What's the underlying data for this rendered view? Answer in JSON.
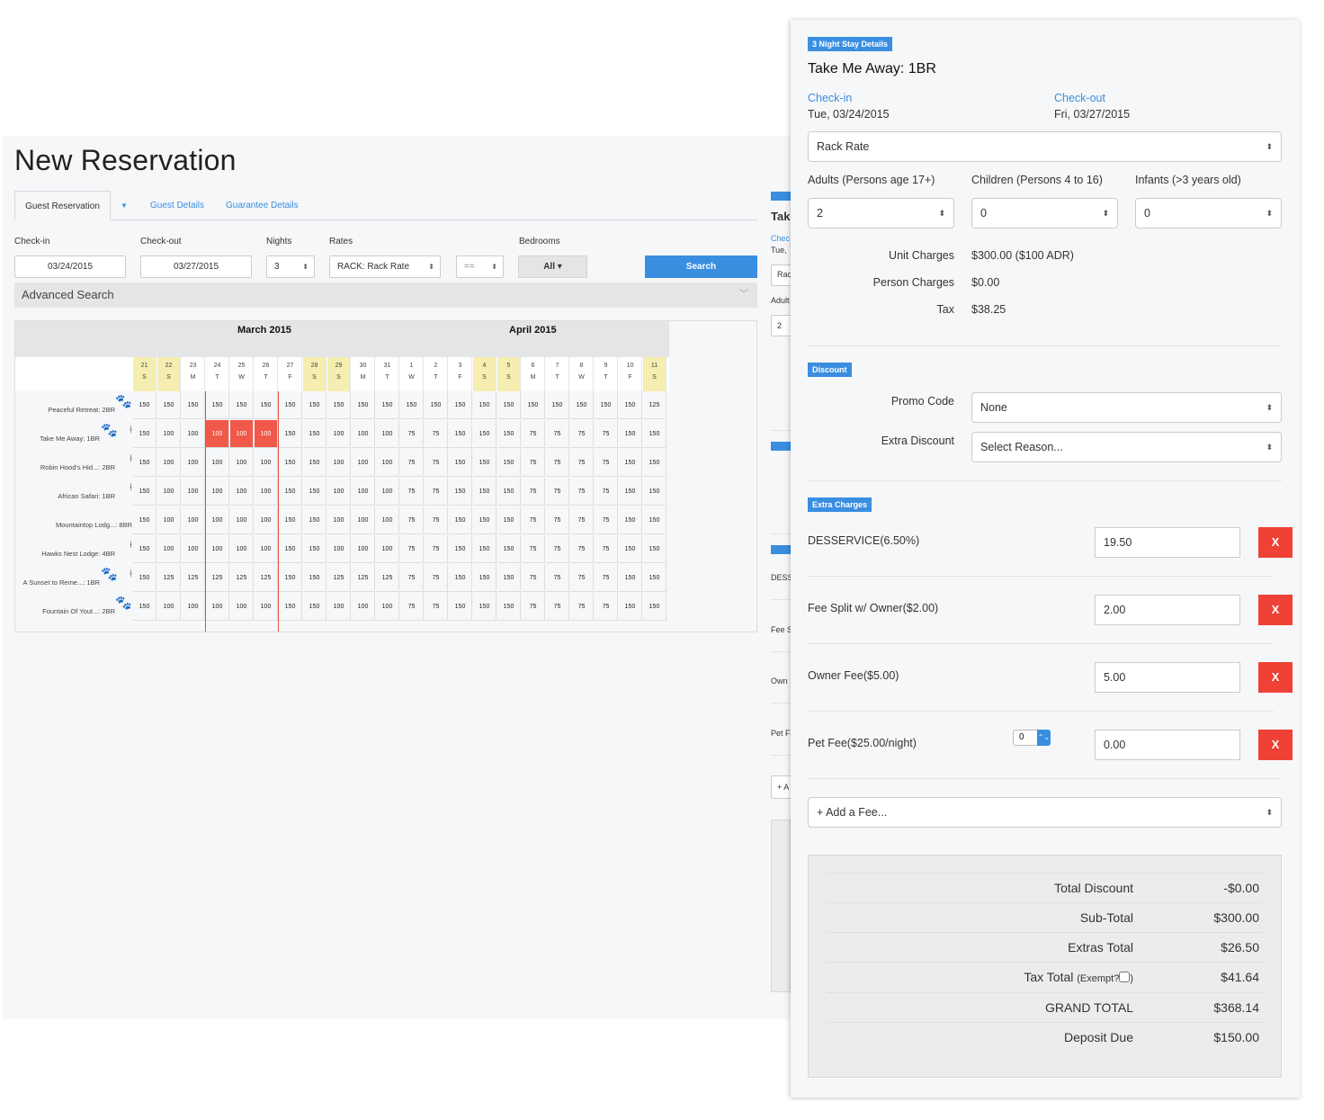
{
  "page": {
    "title": "New Reservation",
    "tabs": [
      {
        "label": "Guest Reservation",
        "active": true
      },
      {
        "label": "Guest Details",
        "active": false
      },
      {
        "label": "Guarantee Details",
        "active": false
      }
    ],
    "tab_caret": "▼"
  },
  "search_form": {
    "checkin_label": "Check-in",
    "checkin_value": "03/24/2015",
    "checkout_label": "Check-out",
    "checkout_value": "03/27/2015",
    "nights_label": "Nights",
    "nights_value": "3",
    "rates_label": "Rates",
    "rates_value": "RACK: Rack Rate",
    "operator_value": "==",
    "bedrooms_label": "Bedrooms",
    "bedrooms_value": "All ▾",
    "search_button": "Search",
    "advanced_search": "Advanced Search",
    "spin_glyph": "⬍",
    "chevron_glyph": "﹀"
  },
  "calendar": {
    "months": [
      {
        "label": "March 2015"
      },
      {
        "label": "April 2015"
      }
    ],
    "days": [
      {
        "num": "21",
        "dow": "S",
        "weekend": true
      },
      {
        "num": "22",
        "dow": "S",
        "weekend": true
      },
      {
        "num": "23",
        "dow": "M",
        "weekend": false
      },
      {
        "num": "24",
        "dow": "T",
        "weekend": false
      },
      {
        "num": "25",
        "dow": "W",
        "weekend": false
      },
      {
        "num": "26",
        "dow": "T",
        "weekend": false
      },
      {
        "num": "27",
        "dow": "F",
        "weekend": false
      },
      {
        "num": "28",
        "dow": "S",
        "weekend": true
      },
      {
        "num": "29",
        "dow": "S",
        "weekend": true
      },
      {
        "num": "30",
        "dow": "M",
        "weekend": false
      },
      {
        "num": "31",
        "dow": "T",
        "weekend": false
      },
      {
        "num": "1",
        "dow": "W",
        "weekend": false
      },
      {
        "num": "2",
        "dow": "T",
        "weekend": false
      },
      {
        "num": "3",
        "dow": "F",
        "weekend": false
      },
      {
        "num": "4",
        "dow": "S",
        "weekend": true
      },
      {
        "num": "5",
        "dow": "S",
        "weekend": true
      },
      {
        "num": "6",
        "dow": "M",
        "weekend": false
      },
      {
        "num": "7",
        "dow": "T",
        "weekend": false
      },
      {
        "num": "8",
        "dow": "W",
        "weekend": false
      },
      {
        "num": "9",
        "dow": "T",
        "weekend": false
      },
      {
        "num": "10",
        "dow": "F",
        "weekend": false
      },
      {
        "num": "11",
        "dow": "S",
        "weekend": true
      }
    ],
    "selected_range": {
      "unit_index": 1,
      "start_day_index": 3,
      "end_day_index": 5
    },
    "units": [
      {
        "name": "Peaceful Retreat: 2BR",
        "pets": true,
        "cleaning": false,
        "rates": [
          "150",
          "150",
          "150",
          "150",
          "150",
          "150",
          "150",
          "150",
          "150",
          "150",
          "150",
          "150",
          "150",
          "150",
          "150",
          "150",
          "150",
          "150",
          "150",
          "150",
          "150",
          "125"
        ]
      },
      {
        "name": "Take Me Away: 1BR",
        "pets": true,
        "cleaning": true,
        "rates": [
          "150",
          "100",
          "100",
          "100",
          "100",
          "100",
          "150",
          "150",
          "100",
          "100",
          "100",
          "75",
          "75",
          "150",
          "150",
          "150",
          "75",
          "75",
          "75",
          "75",
          "150",
          "150"
        ]
      },
      {
        "name": "Robin Hood's Hid...: 2BR",
        "pets": false,
        "cleaning": true,
        "rates": [
          "150",
          "100",
          "100",
          "100",
          "100",
          "100",
          "150",
          "150",
          "100",
          "100",
          "100",
          "75",
          "75",
          "150",
          "150",
          "150",
          "75",
          "75",
          "75",
          "75",
          "150",
          "150"
        ]
      },
      {
        "name": "African Safari: 1BR",
        "pets": false,
        "cleaning": true,
        "rates": [
          "150",
          "100",
          "100",
          "100",
          "100",
          "100",
          "150",
          "150",
          "100",
          "100",
          "100",
          "75",
          "75",
          "150",
          "150",
          "150",
          "75",
          "75",
          "75",
          "75",
          "150",
          "150"
        ]
      },
      {
        "name": "Mountaintop Lodg...: 8BR",
        "pets": false,
        "cleaning": false,
        "rates": [
          "150",
          "100",
          "100",
          "100",
          "100",
          "100",
          "150",
          "150",
          "100",
          "100",
          "100",
          "75",
          "75",
          "150",
          "150",
          "150",
          "75",
          "75",
          "75",
          "75",
          "150",
          "150"
        ]
      },
      {
        "name": "Hawks Nest Lodge: 4BR",
        "pets": false,
        "cleaning": true,
        "rates": [
          "150",
          "100",
          "100",
          "100",
          "100",
          "100",
          "150",
          "150",
          "100",
          "100",
          "100",
          "75",
          "75",
          "150",
          "150",
          "150",
          "75",
          "75",
          "75",
          "75",
          "150",
          "150"
        ]
      },
      {
        "name": "A Sunset to Reme...: 1BR",
        "pets": true,
        "cleaning": true,
        "rates": [
          "150",
          "125",
          "125",
          "125",
          "125",
          "125",
          "150",
          "150",
          "125",
          "125",
          "125",
          "75",
          "75",
          "150",
          "150",
          "150",
          "75",
          "75",
          "75",
          "75",
          "150",
          "150"
        ]
      },
      {
        "name": "Fountain Of Yout...: 2BR",
        "pets": true,
        "cleaning": false,
        "rates": [
          "150",
          "100",
          "100",
          "100",
          "100",
          "100",
          "150",
          "150",
          "100",
          "100",
          "100",
          "75",
          "75",
          "150",
          "150",
          "150",
          "75",
          "75",
          "75",
          "75",
          "150",
          "150"
        ]
      }
    ],
    "icons": {
      "paw": "🐾",
      "broom": "⟊"
    }
  },
  "peek_panel": {
    "title": "Tak",
    "checkin_link": "Chec",
    "checkin_date": "Tue,",
    "rate": "Rac",
    "adults_label": "Adult",
    "adults_value": "2",
    "row1": "DESS",
    "row2": "Fee S",
    "row3": "Own",
    "row4": "Pet F",
    "add_fee": "+ A"
  },
  "stay_panel": {
    "badge": "3 Night Stay Details",
    "unit_title": "Take Me Away: 1BR",
    "checkin_label": "Check-in",
    "checkin_date": "Tue, 03/24/2015",
    "checkout_label": "Check-out",
    "checkout_date": "Fri, 03/27/2015",
    "rate_select": "Rack Rate",
    "adults_label": "Adults (Persons age 17+)",
    "adults_value": "2",
    "children_label": "Children (Persons 4 to 16)",
    "children_value": "0",
    "infants_label": "Infants (>3 years old)",
    "infants_value": "0",
    "unit_charges_label": "Unit Charges",
    "unit_charges_value": "$300.00 ($100 ADR)",
    "person_charges_label": "Person Charges",
    "person_charges_value": "$0.00",
    "tax_label": "Tax",
    "tax_value": "$38.25",
    "select_arrows": "⬍",
    "discount": {
      "badge": "Discount",
      "promo_label": "Promo Code",
      "promo_value": "None",
      "extra_label": "Extra Discount",
      "extra_value": "Select Reason..."
    },
    "extra_charges": {
      "badge": "Extra Charges",
      "remove_label": "X",
      "items": [
        {
          "label": "DESSERVICE(6.50%)",
          "value": "19.50"
        },
        {
          "label": "Fee Split w/ Owner($2.00)",
          "value": "2.00"
        },
        {
          "label": "Owner Fee($5.00)",
          "value": "5.00"
        },
        {
          "label": "Pet Fee($25.00/night)",
          "value": "0.00",
          "pet_count": "0"
        }
      ],
      "stepper_glyph": "⌃⌄",
      "add_fee": "+ Add a Fee..."
    },
    "totals": {
      "total_discount_label": "Total Discount",
      "total_discount": "-$0.00",
      "subtotal_label": "Sub-Total",
      "subtotal": "$300.00",
      "extras_label": "Extras Total",
      "extras": "$26.50",
      "tax_label": "Tax Total",
      "tax_exempt_label": "(Exempt?",
      "tax_exempt_close": ")",
      "tax_exempt_checked": false,
      "tax": "$41.64",
      "grand_label": "GRAND TOTAL",
      "grand": "$368.14",
      "deposit_label": "Deposit Due",
      "deposit": "$150.00"
    }
  },
  "colors": {
    "accent": "#3a8ee0",
    "danger": "#ef4136",
    "selected_cell": "#f0594a",
    "weekend": "#f5eeb0",
    "range_line": "#e8513f"
  }
}
